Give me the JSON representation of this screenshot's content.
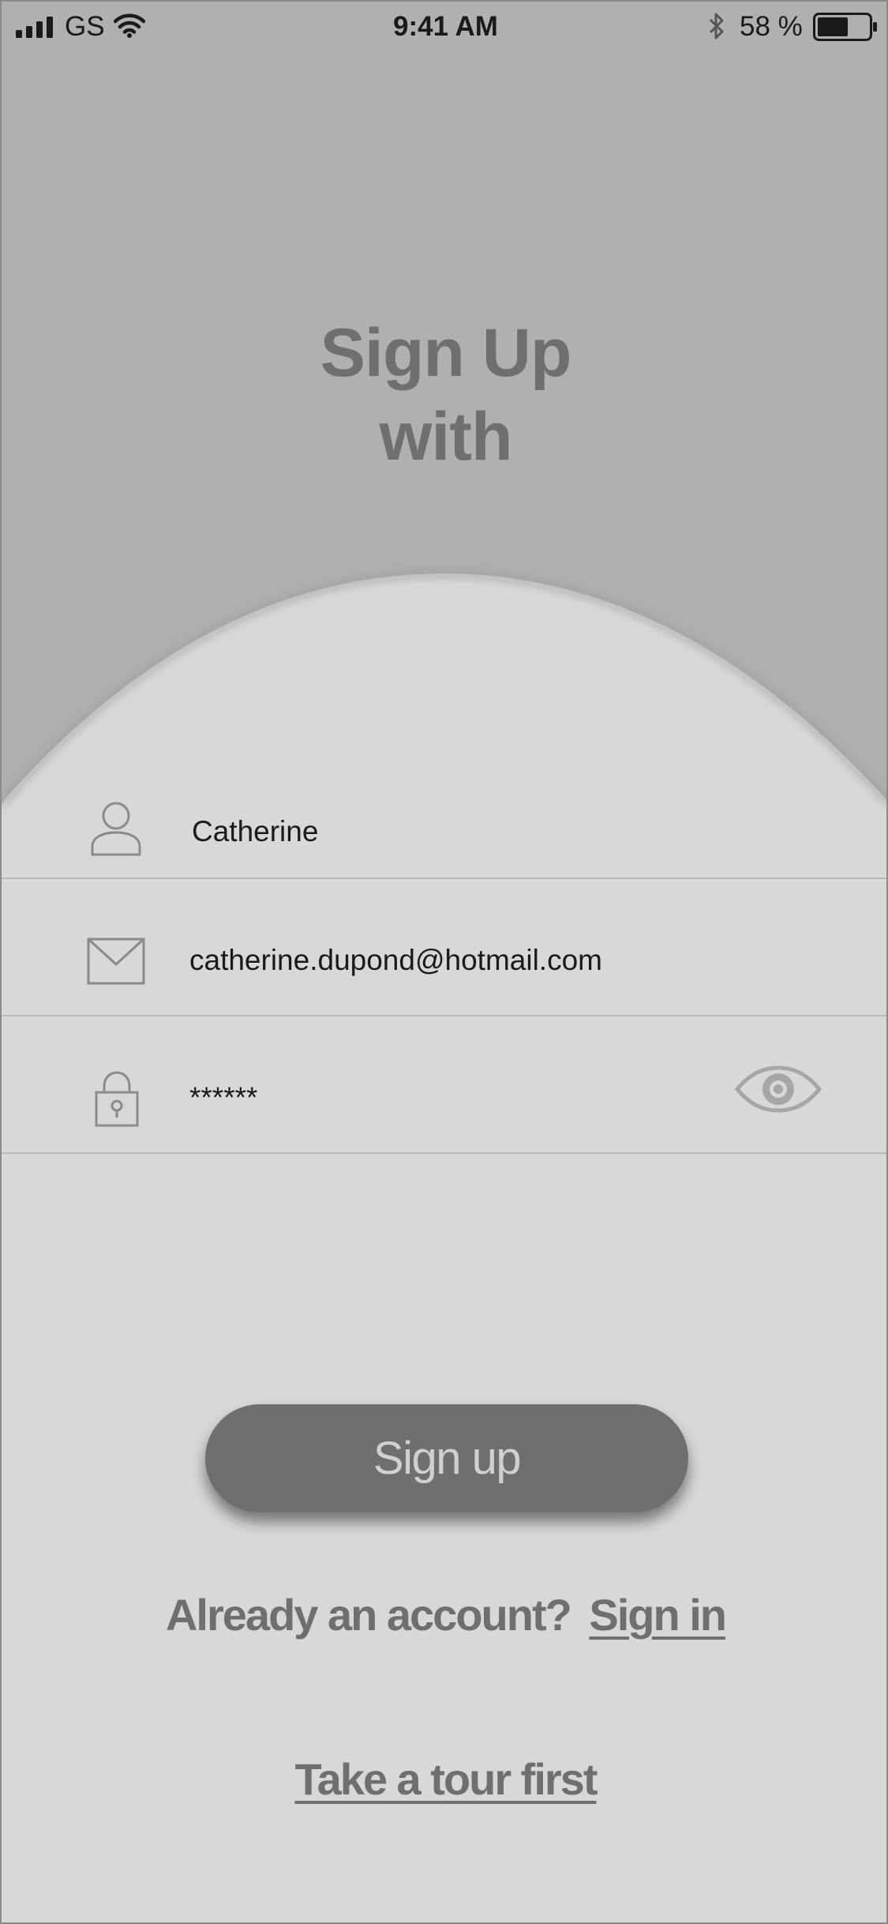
{
  "status_bar": {
    "carrier": "GS",
    "time": "9:41 AM",
    "battery_percent": "58 %"
  },
  "header": {
    "title_line1": "Sign Up",
    "title_line2": "with"
  },
  "form": {
    "name_value": "Catherine",
    "email_value": "catherine.dupond@hotmail.com",
    "password_value": "******"
  },
  "actions": {
    "signup_label": "Sign up",
    "account_prompt": "Already an account?",
    "signin_label": "Sign in",
    "tour_label": "Take a tour first"
  },
  "colors": {
    "header_bg": "#b0b0b0",
    "body_bg": "#d8d8d8",
    "button_bg": "#6f6f6f",
    "accent_text": "#6f6f6f"
  }
}
